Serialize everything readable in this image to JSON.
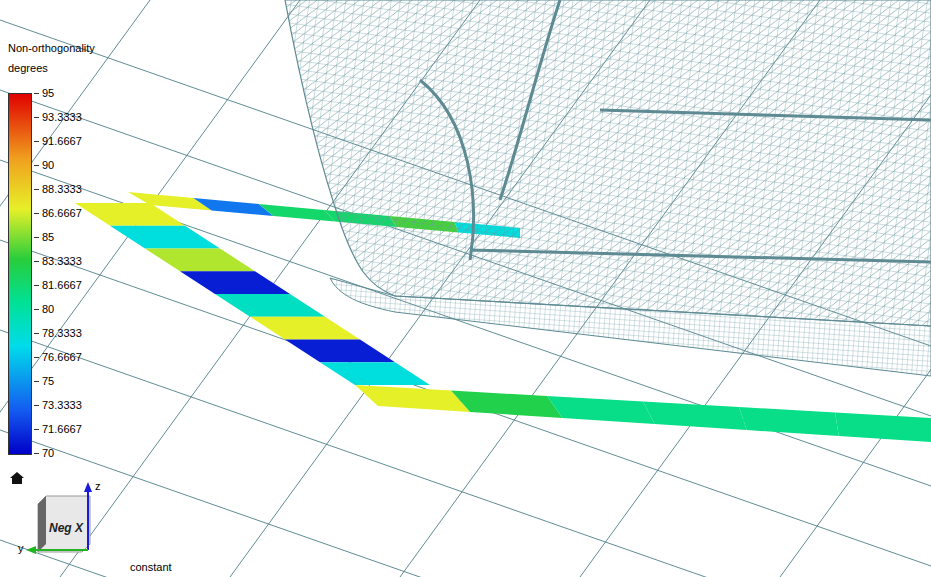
{
  "colorbar": {
    "title": "Non-orthogonality",
    "units": "degrees",
    "min": 70,
    "max": 95,
    "ticks": [
      "95",
      "93.3333",
      "91.6667",
      "90",
      "88.3333",
      "86.6667",
      "85",
      "83.3333",
      "81.6667",
      "80",
      "78.3333",
      "76.6667",
      "75",
      "73.3333",
      "71.6667",
      "70"
    ]
  },
  "strips": [
    {
      "values": [
        87,
        74,
        82,
        82,
        84,
        78
      ]
    },
    {
      "values": [
        87,
        78,
        86,
        71,
        79,
        87,
        71,
        78
      ]
    },
    {
      "values": [
        87,
        83,
        81,
        81,
        81,
        81
      ]
    }
  ],
  "orientation": {
    "label": "Neg X",
    "axes": [
      "z",
      "y"
    ]
  },
  "footer": {
    "label": "constant"
  }
}
